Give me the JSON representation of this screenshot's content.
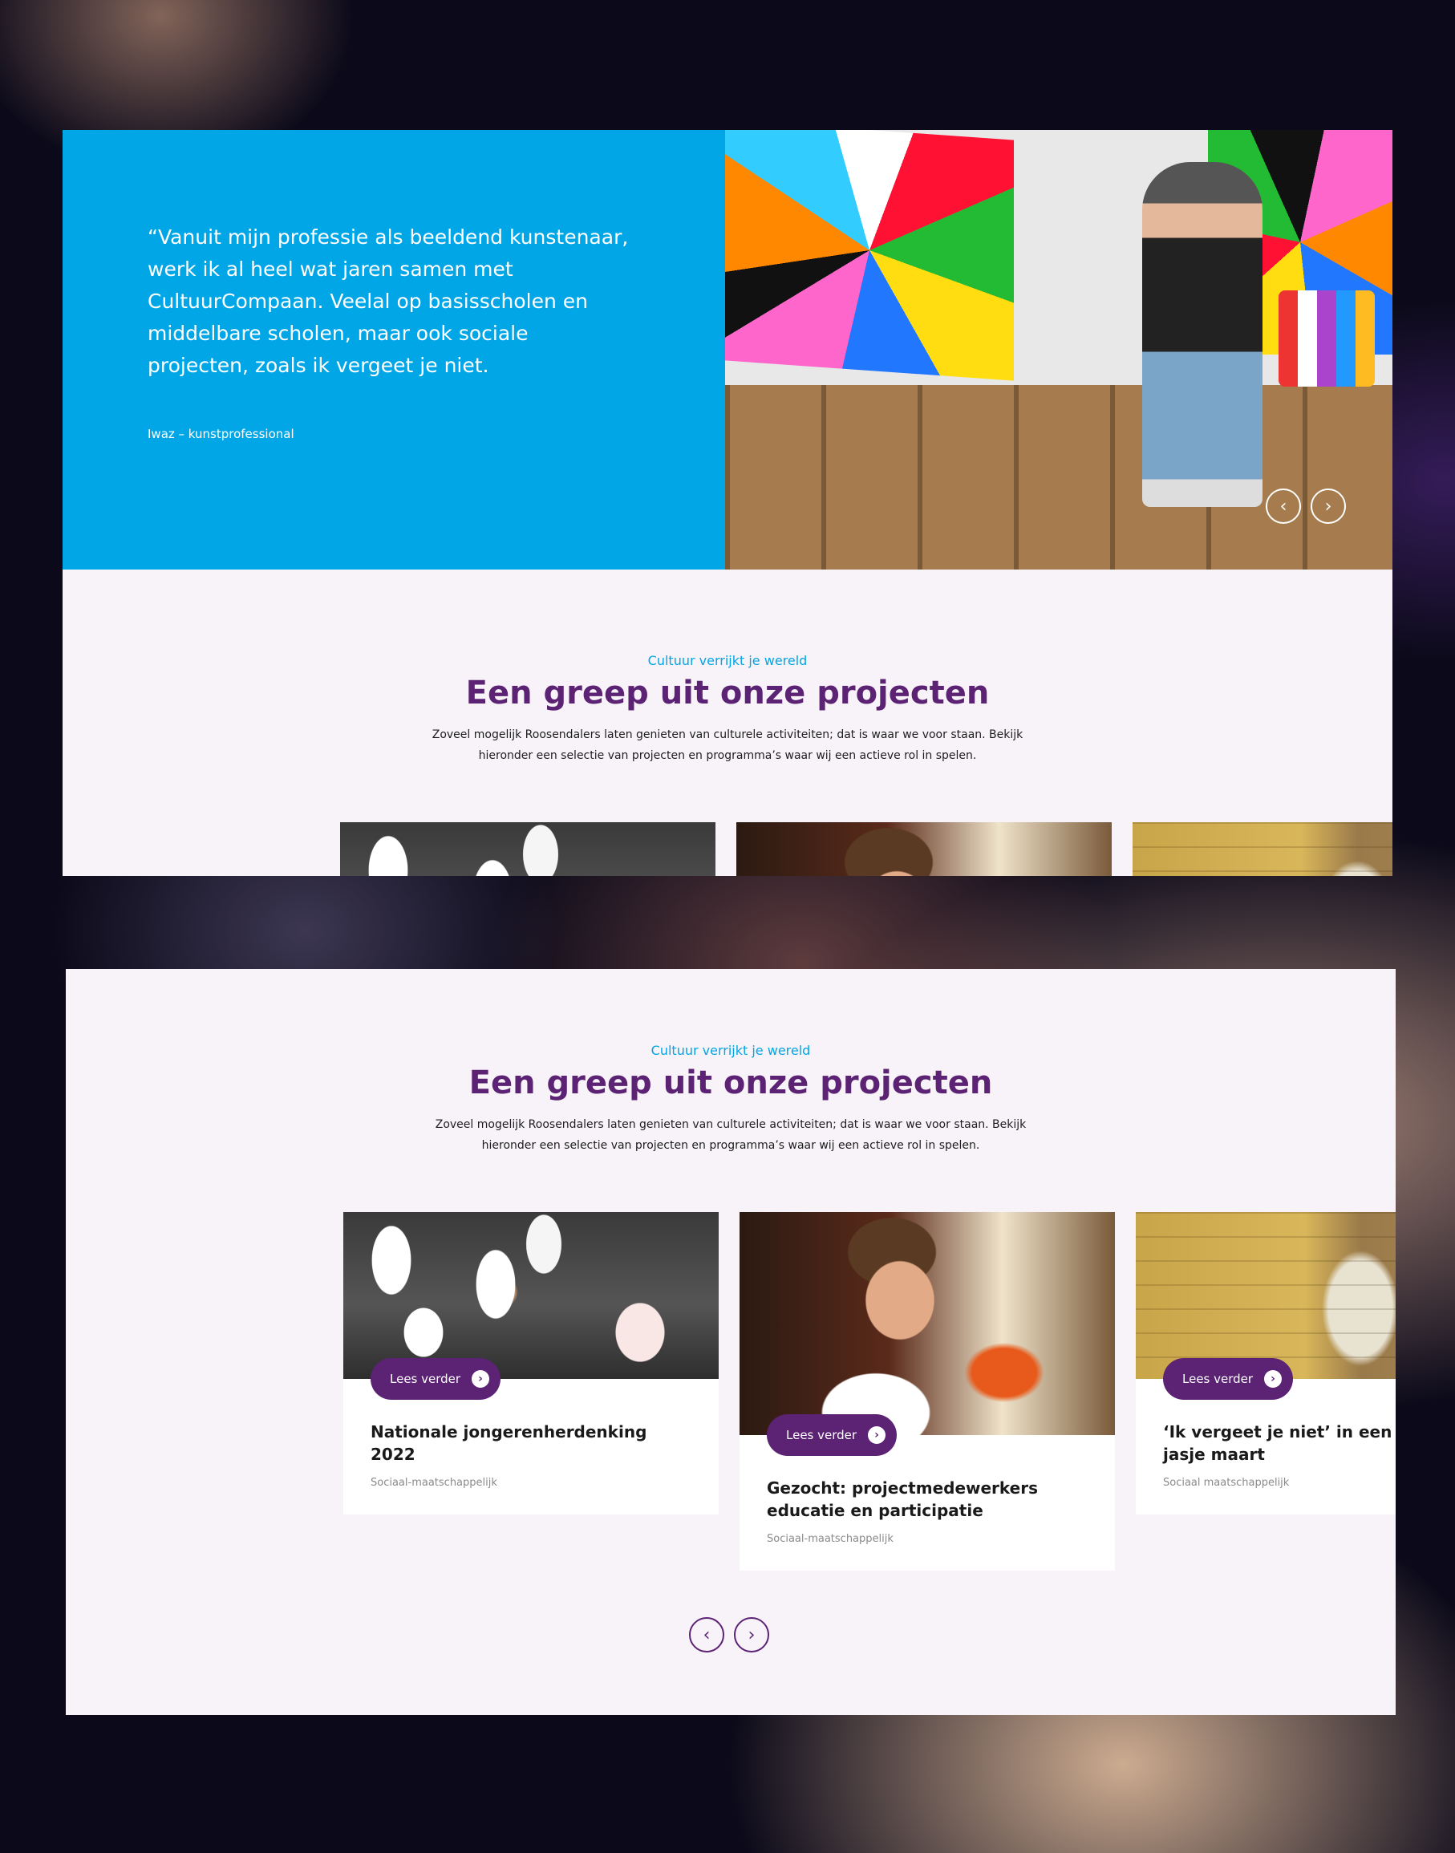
{
  "testimonial": {
    "quote": "“Vanuit mijn professie als beeldend kunstenaar, werk ik al heel wat jaren samen met CultuurCompaan. Veelal op basisscholen en middelbare scholen, maar ook sociale projecten, zoals ik vergeet je niet.",
    "author": "Iwaz – kunstprofessional",
    "prev_icon": "‹",
    "next_icon": "›"
  },
  "projects": {
    "kicker": "Cultuur verrijkt je wereld",
    "title": "Een greep uit onze projecten",
    "intro": "Zoveel mogelijk Roosendalers laten genieten van culturele activiteiten; dat is waar we voor staan. Bekijk hieronder een selectie van projecten en programma’s waar wij een actieve rol in spelen.",
    "cards": [
      {
        "button": "Lees verder",
        "title": "Nationale jongerenherdenking 2022",
        "category": "Sociaal-maatschappelijk"
      },
      {
        "button": "Lees verder",
        "title": "Gezocht: projectmedewerkers educatie en participatie",
        "category": "Sociaal-maatschappelijk"
      },
      {
        "button": "Lees verder",
        "title": "‘Ik vergeet je niet’ in een nieuw jasje maart",
        "category": "Sociaal maatschappelijk"
      }
    ],
    "button_icon": "›",
    "prev_icon": "‹",
    "next_icon": "›"
  },
  "colors": {
    "accent_blue": "#00a6e5",
    "brand_purple": "#5c2374",
    "section_bg": "#f8f3f9"
  }
}
